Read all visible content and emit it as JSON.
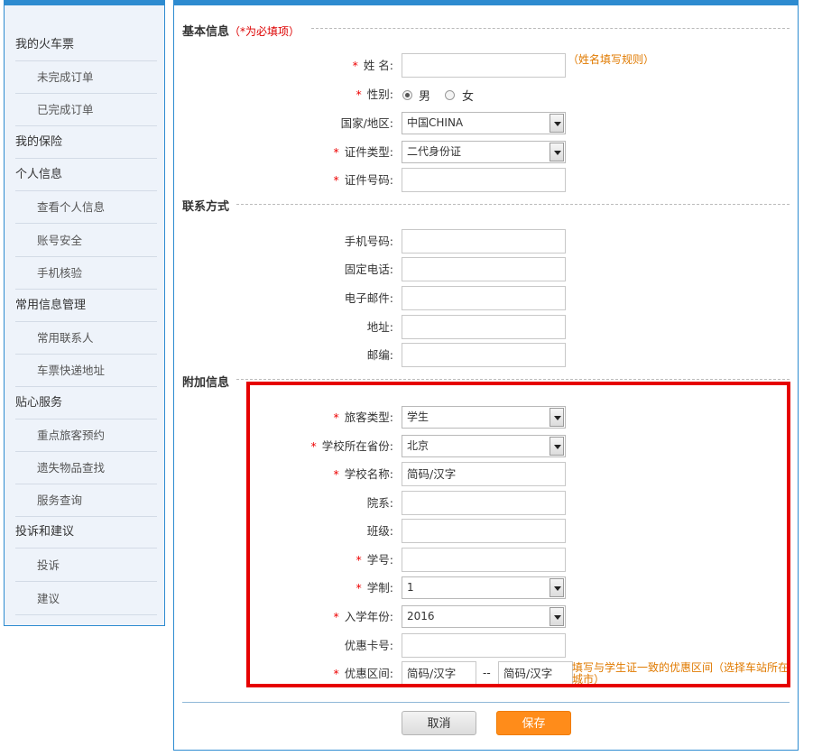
{
  "sidebar": {
    "items": [
      {
        "label": "我的火车票",
        "sub": false
      },
      {
        "label": "未完成订单",
        "sub": true
      },
      {
        "label": "已完成订单",
        "sub": true
      },
      {
        "label": "我的保险",
        "sub": false
      },
      {
        "label": "个人信息",
        "sub": false
      },
      {
        "label": "查看个人信息",
        "sub": true
      },
      {
        "label": "账号安全",
        "sub": true
      },
      {
        "label": "手机核验",
        "sub": true
      },
      {
        "label": "常用信息管理",
        "sub": false
      },
      {
        "label": "常用联系人",
        "sub": true
      },
      {
        "label": "车票快递地址",
        "sub": true
      },
      {
        "label": "贴心服务",
        "sub": false
      },
      {
        "label": "重点旅客预约",
        "sub": true
      },
      {
        "label": "遗失物品查找",
        "sub": true
      },
      {
        "label": "服务查询",
        "sub": true
      },
      {
        "label": "投诉和建议",
        "sub": false
      },
      {
        "label": "投诉",
        "sub": true
      },
      {
        "label": "建议",
        "sub": true
      }
    ]
  },
  "basic": {
    "title": "基本信息",
    "required_note": "（*为必填项）",
    "name_label": "姓  名:",
    "name_hint": "（姓名填写规则）",
    "gender_label": "性别:",
    "gender_male": "男",
    "gender_female": "女",
    "country_label": "国家/地区:",
    "country_value": "中国CHINA",
    "idtype_label": "证件类型:",
    "idtype_value": "二代身份证",
    "idnum_label": "证件号码:"
  },
  "contact": {
    "title": "联系方式",
    "mobile_label": "手机号码:",
    "phone_label": "固定电话:",
    "email_label": "电子邮件:",
    "address_label": "地址:",
    "zip_label": "邮编:"
  },
  "extra": {
    "title": "附加信息",
    "passenger_type_label": "旅客类型:",
    "passenger_type_value": "学生",
    "province_label": "学校所在省份:",
    "province_value": "北京",
    "school_label": "学校名称:",
    "school_placeholder": "简码/汉字",
    "dept_label": "院系:",
    "class_label": "班级:",
    "student_no_label": "学号:",
    "duration_label": "学制:",
    "duration_value": "1",
    "enroll_label": "入学年份:",
    "enroll_value": "2016",
    "card_label": "优惠卡号:",
    "range_label": "优惠区间:",
    "range_from_placeholder": "简码/汉字",
    "range_sep": "--",
    "range_to_placeholder": "简码/汉字",
    "range_hint": "填写与学生证一致的优惠区间（选择车站所在城市）"
  },
  "buttons": {
    "cancel": "取消",
    "save": "保存"
  },
  "colors": {
    "accent_blue": "#2d8bd0",
    "required_red": "#e00000",
    "hint_orange": "#e07a00",
    "save_orange": "#ff8c1a"
  }
}
